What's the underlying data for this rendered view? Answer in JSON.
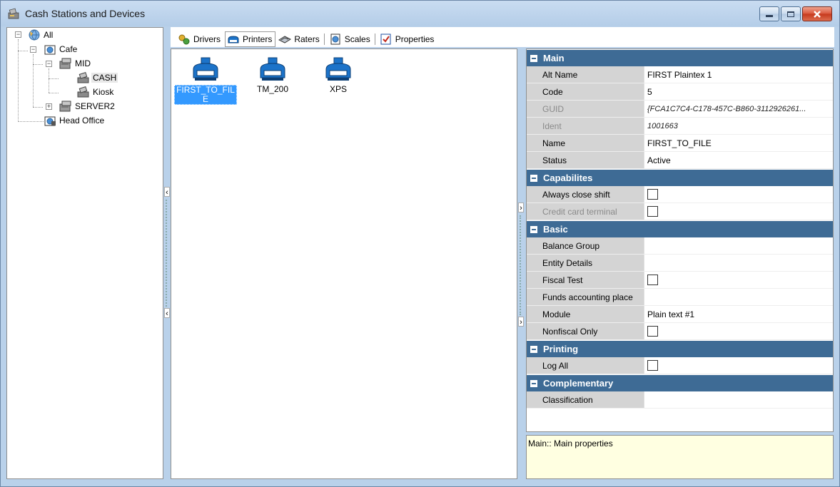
{
  "window": {
    "title": "Cash Stations and Devices"
  },
  "tree": {
    "items": [
      {
        "label": "All"
      },
      {
        "label": "Cafe"
      },
      {
        "label": "MID"
      },
      {
        "label": "CASH"
      },
      {
        "label": "Kiosk"
      },
      {
        "label": "SERVER2"
      },
      {
        "label": "Head Office"
      }
    ]
  },
  "toolbar": {
    "tabs": [
      {
        "label": "Drivers"
      },
      {
        "label": "Printers"
      },
      {
        "label": "Raters"
      },
      {
        "label": "Scales"
      },
      {
        "label": "Properties"
      }
    ]
  },
  "printers": [
    {
      "label": "FIRST_TO_FILE",
      "selected": true
    },
    {
      "label": "TM_200"
    },
    {
      "label": "XPS"
    }
  ],
  "properties": {
    "main": {
      "title": "Main",
      "rows": [
        {
          "name": "Alt Name",
          "value": "FIRST Plaintex 1"
        },
        {
          "name": "Code",
          "value": "5"
        },
        {
          "name": "GUID",
          "value": "{FCA1C7C4-C178-457C-B860-3112926261..."
        },
        {
          "name": "Ident",
          "value": "1001663"
        },
        {
          "name": "Name",
          "value": "FIRST_TO_FILE"
        },
        {
          "name": "Status",
          "value": "Active"
        }
      ]
    },
    "capabilities": {
      "title": "Capabilites",
      "rows": [
        {
          "name": "Always close shift"
        },
        {
          "name": "Credit card terminal"
        }
      ]
    },
    "basic": {
      "title": "Basic",
      "rows": [
        {
          "name": "Balance Group",
          "value": ""
        },
        {
          "name": "Entity Details",
          "value": ""
        },
        {
          "name": "Fiscal Test"
        },
        {
          "name": "Funds accounting place",
          "value": ""
        },
        {
          "name": "Module",
          "value": "Plain text #1"
        },
        {
          "name": "Nonfiscal Only"
        }
      ]
    },
    "printing": {
      "title": "Printing",
      "rows": [
        {
          "name": "Log All"
        }
      ]
    },
    "complementary": {
      "title": "Complementary",
      "rows": [
        {
          "name": "Classification",
          "value": ""
        }
      ]
    }
  },
  "description": {
    "text": "Main:: Main properties"
  },
  "colors": {
    "category_header": "#3e6b95",
    "selection": "#3399ff",
    "description_bg": "#ffffe1"
  }
}
